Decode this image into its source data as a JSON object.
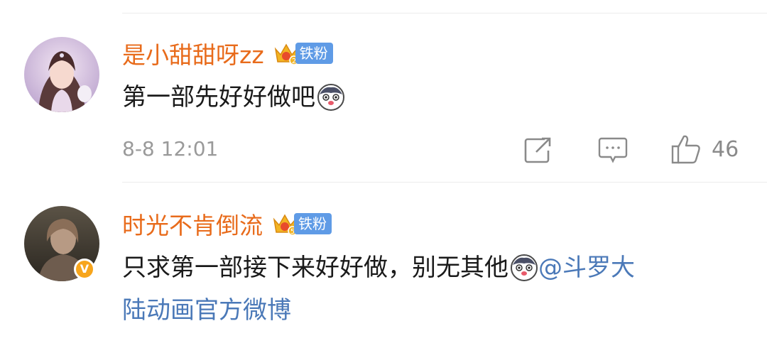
{
  "comments": [
    {
      "username": "是小甜甜呀zz",
      "fan_level": "2",
      "fan_label": "铁粉",
      "text": "第一部先好好做吧",
      "emoji": "husky-emoji",
      "timestamp": "8-8 12:01",
      "likes": "46"
    },
    {
      "username": "时光不肯倒流",
      "fan_level": "5",
      "fan_label": "铁粉",
      "verified_mark": "V",
      "text_line1": "只求第一部接下来好好做，别无其他",
      "emoji": "husky-emoji",
      "mention_part1": "@斗罗大",
      "mention_part2": "陆动画官方微博"
    }
  ],
  "icons": {
    "share": "share-icon",
    "comment": "comment-icon",
    "like": "thumbs-up-icon"
  },
  "colors": {
    "username": "#e86b1b",
    "mention": "#4b79b8",
    "fan_badge": "#5f9be6",
    "crown": "#f3b422",
    "meta": "#9a9a9a"
  }
}
